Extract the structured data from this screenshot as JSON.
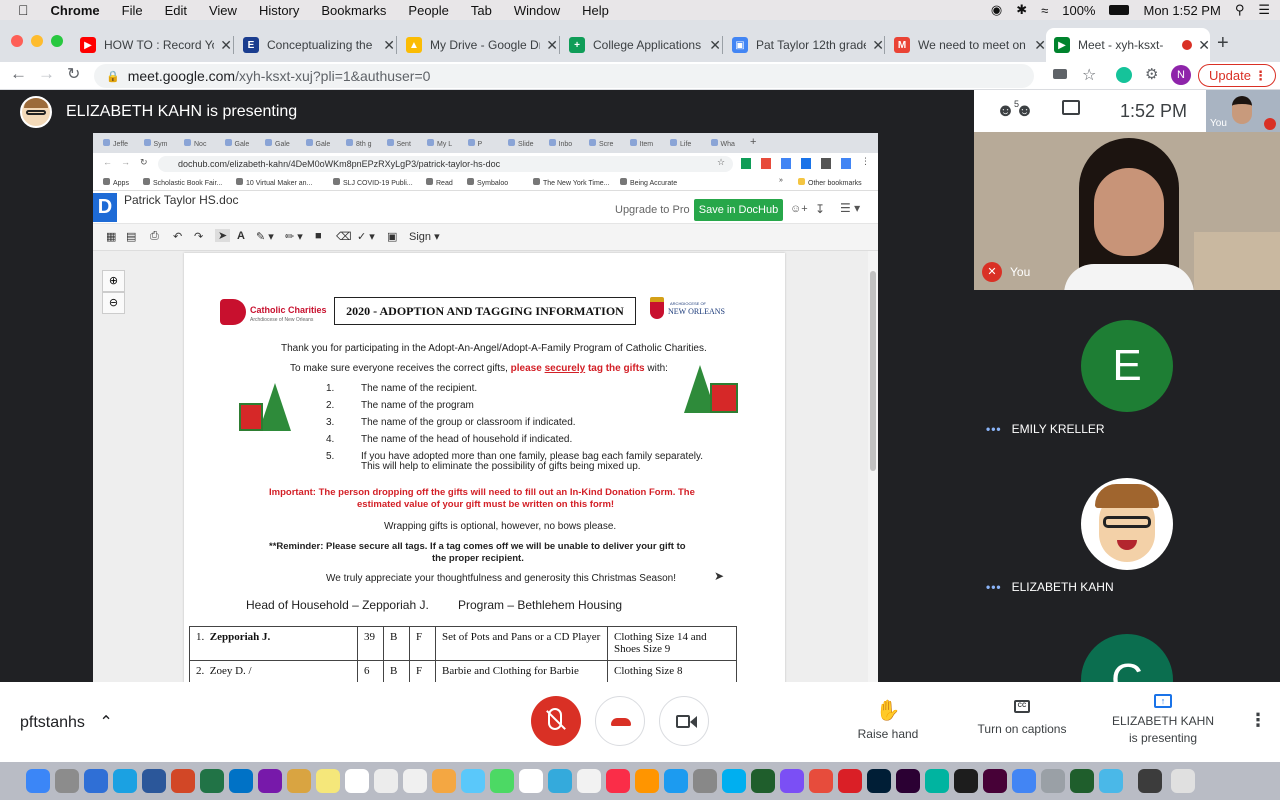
{
  "menubar": {
    "app": "Chrome",
    "items": [
      "File",
      "Edit",
      "View",
      "History",
      "Bookmarks",
      "People",
      "Tab",
      "Window",
      "Help"
    ],
    "battery": "100%",
    "clock": "Mon 1:52 PM"
  },
  "tabs": [
    {
      "title": "HOW TO : Record Yo",
      "color": "#ff0000",
      "glyph": "▶"
    },
    {
      "title": "Conceptualizing the",
      "color": "#1a3d8f",
      "glyph": "E"
    },
    {
      "title": "My Drive - Google Dr",
      "color": "#fbbc04",
      "glyph": "▲"
    },
    {
      "title": "College Applications",
      "color": "#0f9d58",
      "glyph": "+"
    },
    {
      "title": "Pat Taylor 12th grade",
      "color": "#4285f4",
      "glyph": "▣"
    },
    {
      "title": "We need to meet on",
      "color": "#ea4335",
      "glyph": "M"
    },
    {
      "title": "Meet - xyh-ksxt-",
      "color": "#00832d",
      "glyph": "▶"
    }
  ],
  "address": {
    "host": "meet.google.com",
    "path": "/xyh-ksxt-xuj?pli=1&authuser=0",
    "profile_initial": "N",
    "update_label": "Update"
  },
  "meet": {
    "presenter_banner": "ELIZABETH KAHN is presenting",
    "participant_count": "5",
    "time": "1:52 PM",
    "self_label_small": "You",
    "self_label": "You",
    "participants": [
      {
        "name": "EMILY KRELLER",
        "initial": "E",
        "color": "#1e7e34"
      },
      {
        "name": "ELIZABETH KAHN",
        "initial": "",
        "color": "#ffffff"
      },
      {
        "name": "",
        "initial": "C",
        "color": "#0b6e4f"
      }
    ],
    "meeting_name": "pftstanhs",
    "raise_hand": "Raise hand",
    "captions": "Turn on captions",
    "presenting_line1": "ELIZABETH KAHN",
    "presenting_line2": "is presenting"
  },
  "shared": {
    "inner_tabs": [
      "Jeffe",
      "Sym",
      "Noc",
      "Gale",
      "Gale",
      "Gale",
      "8th g",
      "Sent",
      "My L",
      "P",
      "Slide",
      "Inbo",
      "Scre",
      "Item",
      "Life",
      "Wha"
    ],
    "inner_url": "dochub.com/elizabeth-kahn/4DeM0oWKm8pnEPzRXyLgP3/patrick-taylor-hs-doc",
    "bookmarks": [
      "Apps",
      "Scholastic Book Fair...",
      "10 Virtual Maker an...",
      "SLJ COVID-19 Publi...",
      "Read",
      "Symbaloo",
      "The New York Time...",
      "Being Accurate",
      "Other bookmarks"
    ],
    "doc_title": "Patrick Taylor HS.doc",
    "upgrade": "Upgrade to Pro",
    "save": "Save in DocHub",
    "sign": "Sign",
    "doc": {
      "logo_left": "Catholic Charities",
      "logo_left_sub": "Archdiocese of New Orleans",
      "logo_right": "NEW ORLEANS",
      "logo_right_sub": "ARCHDIOCESE OF",
      "heading": "2020 - ADOPTION AND TAGGING INFORMATION",
      "intro": "Thank you for participating in the Adopt-An-Angel/Adopt-A-Family Program of Catholic Charities.",
      "ensure_pre": "To make sure everyone receives the correct gifts, ",
      "ensure_red_1": "please ",
      "ensure_red_2": "securely",
      "ensure_red_3": " tag the gifts",
      "ensure_post": " with:",
      "list": [
        {
          "n": "1.",
          "t": "The name of the recipient."
        },
        {
          "n": "2.",
          "t": "The name of the program"
        },
        {
          "n": "3.",
          "t": "The name of the group or classroom if indicated."
        },
        {
          "n": "4.",
          "t": "The name of the head of household if indicated."
        },
        {
          "n": "5.",
          "t": "If you have adopted more than one family, please bag each family separately."
        }
      ],
      "list5b": "This will help to eliminate the possibility of gifts being mixed up.",
      "important1": "Important: The person dropping off the gifts will need to fill out an In-Kind Donation Form. The",
      "important2": "estimated value of your gift must be written on this form!",
      "wrapping": "Wrapping gifts is optional, however, no bows please.",
      "reminder1": "**Reminder: Please secure all tags.  If a tag comes off we will be unable to deliver your gift to",
      "reminder2": "the proper recipient.",
      "appreciate": "We truly appreciate your thoughtfulness and generosity this Christmas Season!",
      "head_household": "Head of Household – Zepporiah J.",
      "program": "Program – Bethlehem Housing",
      "rows": [
        {
          "num": "1.",
          "name": "Zepporiah J.",
          "age": "39",
          "b": "B",
          "f": "F",
          "gift": "Set of Pots and Pans or a CD Player",
          "size": "Clothing Size 14 and Shoes Size 9"
        },
        {
          "num": "2.",
          "name": "Zoey D. /",
          "age": "6",
          "b": "B",
          "f": "F",
          "gift": "Barbie and Clothing for Barbie",
          "size": "Clothing Size 8"
        }
      ]
    }
  }
}
